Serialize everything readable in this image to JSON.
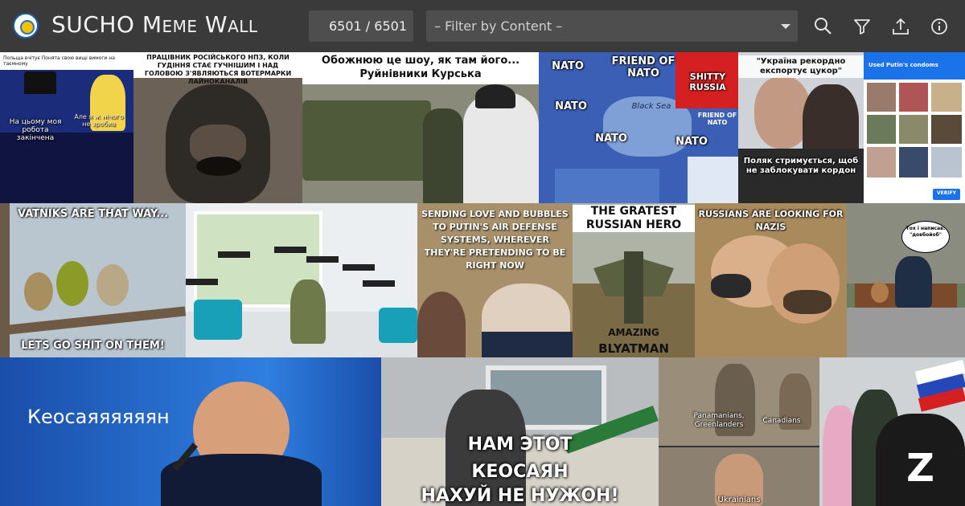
{
  "header": {
    "title_main": "SUCHO",
    "title_small_caps": "Meme Wall",
    "counter": "6501 / 6501",
    "filter_placeholder": "– Filter by Content –"
  },
  "icons": [
    "search-icon",
    "filter-icon",
    "upload-icon",
    "info-icon"
  ],
  "colors": {
    "topbar": "#3a3a3a",
    "field": "#4e4e4e",
    "text": "#f2f2f2"
  },
  "memes": {
    "m1": {
      "cap_top": "Польща вчітує Понята свою вищі вимоги на таємному",
      "cap_left": "На цьому моя робота закінчена",
      "cap_right": "Але я ж нічого не зробив"
    },
    "m2": {
      "cap_top": "ПРАЦІВНИК РОСІЙСЬКОГО НПЗ, КОЛИ ГУДІННЯ СТАЄ ГУЧНІШИМ І НАД ГОЛОВОЮ З'ЯВЛЯЮТЬСЯ ВОТЕРМАРКИ ЛАЙНОКАНАЛІВ"
    },
    "m3": {
      "cap_top": "Обожнюю це шоу, як там його...",
      "cap_bottom": "Руйнівники Курська"
    },
    "m4": {
      "label_friend": "FRIEND OF NATO",
      "label_nato1": "NATO",
      "label_nato2": "NATO",
      "label_nato3": "NATO",
      "label_nato4": "NATO",
      "label_shitty": "SHITTY RUSSIA",
      "label_sea": "Black Sea",
      "label_friend2": "FRIEND OF NATO"
    },
    "m5": {
      "cap_top": "\"Україна рекордно експортує цукор\"",
      "cap_bottom": "Поляк стримується, щоб не заблокувати кордон"
    },
    "m6": {
      "cap_top": "Used Putin's condoms",
      "cap_bottom": "VERIFY"
    },
    "m7": {
      "cap_top": "VATNIKS ARE THAT WAY...",
      "cap_bottom": "LETS GO SHIT ON THEM!"
    },
    "m8": {
      "cap": ""
    },
    "m9": {
      "cap_top": "SENDING LOVE AND BUBBLES TO PUTIN'S AIR DEFENSE SYSTEMS, WHEREVER THEY'RE PRETENDING TO BE RIGHT NOW"
    },
    "m10": {
      "cap_top": "THE GRATEST RUSSIAN HERO",
      "cap_mid": "AMAZING",
      "cap_bottom": "BLYATMAN"
    },
    "m11": {
      "cap_top": "RUSSIANS ARE LOOKING FOR NAZIS"
    },
    "m12": {
      "bubble": "Тох і написав: \"довбойоб\""
    },
    "m13": {
      "cap": "Кеосаяяяяяян"
    },
    "m14": {
      "cap_top": "НАМ ЭТОТ",
      "cap_mid": "КЕОСАЯН",
      "cap_bottom": "НАХУЙ НЕ НУЖОН!"
    },
    "m15": {
      "label_a": "Panamanians, Greenlanders",
      "label_b": "Canadians",
      "label_c": "Ukrainians"
    },
    "m16": {
      "label": "Z"
    }
  }
}
